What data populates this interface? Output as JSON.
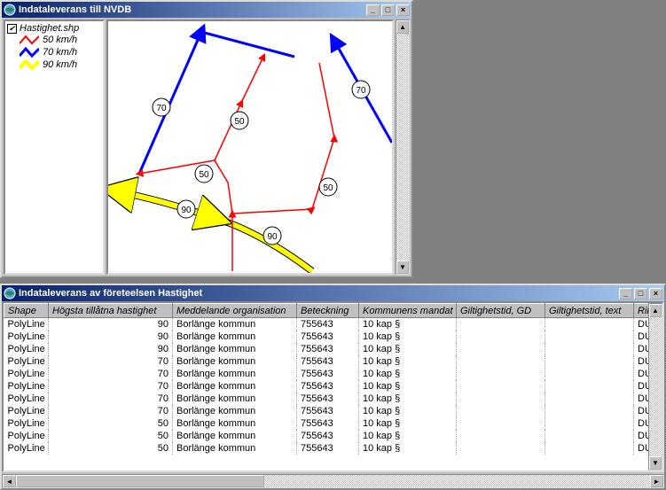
{
  "upper_window": {
    "title": "Indataleverans till NVDB",
    "legend": {
      "layer_name": "Hastighet.shp",
      "items": [
        {
          "label": "50 km/h",
          "color": "#ff0000"
        },
        {
          "label": "70 km/h",
          "color": "#0000ff"
        },
        {
          "label": "90 km/h",
          "color": "#ffff00"
        }
      ]
    },
    "map_labels": [
      "70",
      "70",
      "50",
      "50",
      "50",
      "90",
      "90"
    ]
  },
  "lower_window": {
    "title": "Indataleverans av företeelsen Hastighet",
    "columns": [
      "Shape",
      "Högsta tillåtna hastighet",
      "Meddelande organisation",
      "Beteckning",
      "Kommunens mandat",
      "Giltighetstid, GD",
      "Giltighetstid, text",
      "Riktning"
    ],
    "rows": [
      {
        "shape": "PolyLine",
        "speed": 90,
        "org": "Borlänge kommun",
        "bet": "755643",
        "mandat": "10 kap §",
        "gd": "",
        "gt": "",
        "rikt": "DUBBEL"
      },
      {
        "shape": "PolyLine",
        "speed": 90,
        "org": "Borlänge kommun",
        "bet": "755643",
        "mandat": "10 kap §",
        "gd": "",
        "gt": "",
        "rikt": "DUBBEL"
      },
      {
        "shape": "PolyLine",
        "speed": 90,
        "org": "Borlänge kommun",
        "bet": "755643",
        "mandat": "10 kap §",
        "gd": "",
        "gt": "",
        "rikt": "DUBBEL"
      },
      {
        "shape": "PolyLine",
        "speed": 70,
        "org": "Borlänge kommun",
        "bet": "755643",
        "mandat": "10 kap §",
        "gd": "",
        "gt": "",
        "rikt": "DUBBEL"
      },
      {
        "shape": "PolyLine",
        "speed": 70,
        "org": "Borlänge kommun",
        "bet": "755643",
        "mandat": "10 kap §",
        "gd": "",
        "gt": "",
        "rikt": "DUBBEL"
      },
      {
        "shape": "PolyLine",
        "speed": 70,
        "org": "Borlänge kommun",
        "bet": "755643",
        "mandat": "10 kap §",
        "gd": "",
        "gt": "",
        "rikt": "DUBBEL"
      },
      {
        "shape": "PolyLine",
        "speed": 70,
        "org": "Borlänge kommun",
        "bet": "755643",
        "mandat": "10 kap §",
        "gd": "",
        "gt": "",
        "rikt": "DUBBEL"
      },
      {
        "shape": "PolyLine",
        "speed": 70,
        "org": "Borlänge kommun",
        "bet": "755643",
        "mandat": "10 kap §",
        "gd": "",
        "gt": "",
        "rikt": "DUBBEL"
      },
      {
        "shape": "PolyLine",
        "speed": 50,
        "org": "Borlänge kommun",
        "bet": "755643",
        "mandat": "10 kap §",
        "gd": "",
        "gt": "",
        "rikt": "DUBBEL"
      },
      {
        "shape": "PolyLine",
        "speed": 50,
        "org": "Borlänge kommun",
        "bet": "755643",
        "mandat": "10 kap §",
        "gd": "",
        "gt": "",
        "rikt": "DUBBEL"
      },
      {
        "shape": "PolyLine",
        "speed": 50,
        "org": "Borlänge kommun",
        "bet": "755643",
        "mandat": "10 kap §",
        "gd": "",
        "gt": "",
        "rikt": "DUBBEL"
      }
    ]
  }
}
